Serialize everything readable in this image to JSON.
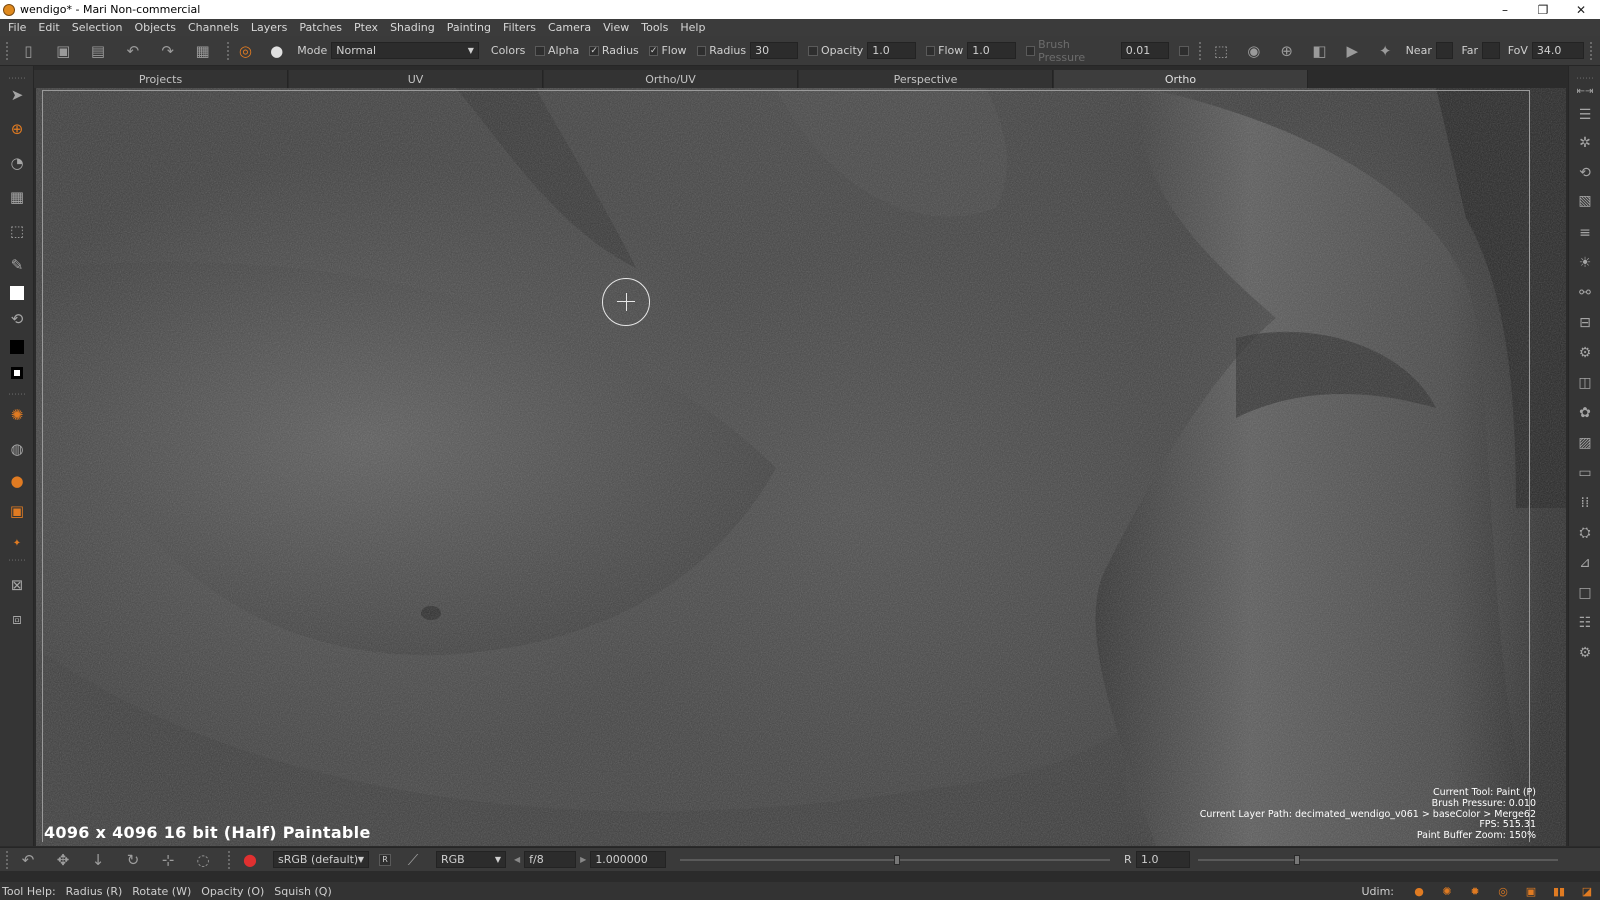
{
  "window": {
    "title": "wendigo* - Mari Non-commercial",
    "minimize": "–",
    "restore": "❐",
    "close": "✕"
  },
  "menu": [
    "File",
    "Edit",
    "Selection",
    "Objects",
    "Channels",
    "Layers",
    "Patches",
    "Ptex",
    "Shading",
    "Painting",
    "Filters",
    "Camera",
    "View",
    "Tools",
    "Help"
  ],
  "toolbar": {
    "mode_label": "Mode",
    "mode_value": "Normal",
    "colors_label": "Colors",
    "alpha_label": "Alpha",
    "radius_label": "Radius",
    "flow_label": "Flow",
    "radius_field_label": "Radius",
    "radius_value": "30",
    "opacity_label": "Opacity",
    "opacity_value": "1.0",
    "flow_field_label": "Flow",
    "flow_value": "1.0",
    "brush_pressure_label": "Brush Pressure",
    "brush_pressure_value": "0.01",
    "near_label": "Near",
    "far_label": "Far",
    "fov_label": "FoV",
    "fov_value": "34.0",
    "checkmark": "✓"
  },
  "tabs": [
    "Projects",
    "UV",
    "Ortho/UV",
    "Perspective",
    "Ortho"
  ],
  "active_tab": "Ortho",
  "viewport": {
    "resolution": "4096 x 4096 16 bit (Half) Paintable",
    "info": [
      "Current Tool: Paint (P)",
      "Brush Pressure: 0.010",
      "Current Layer Path: decimated_wendigo_v061 > baseColor > Merge62",
      "FPS: 515.31",
      "Paint Buffer Zoom: 150%"
    ]
  },
  "bottombar": {
    "colorspace": "sRGB (default)",
    "r_badge": "R",
    "channel": "RGB",
    "fstop": "f/8",
    "exposure": "1.000000",
    "gain_label": "R",
    "gain_value": "1.0"
  },
  "status": {
    "tool_help": "Tool Help:",
    "hints": [
      "Radius (R)",
      "Rotate (W)",
      "Opacity (O)",
      "Squish (Q)"
    ],
    "udim_label": "Udim:"
  },
  "colors": {
    "accent": "#e07b22",
    "panel": "#3a3a3a",
    "viewport_bg": "#3d3d3d"
  }
}
